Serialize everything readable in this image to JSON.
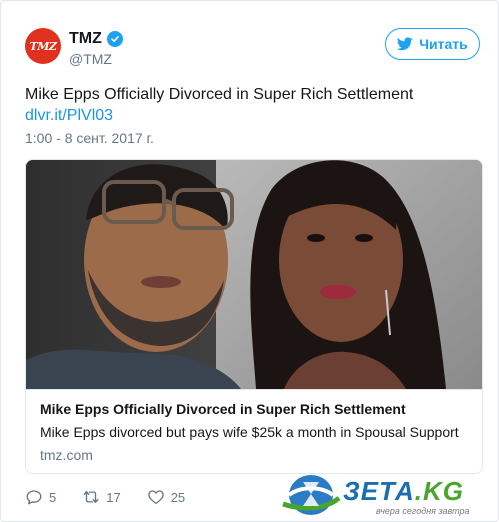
{
  "author": {
    "avatar_text": "TMZ",
    "name": "TMZ",
    "handle": "@TMZ",
    "verified": true
  },
  "follow_button": {
    "label": "Читать",
    "icon": "twitter-bird-icon"
  },
  "tweet": {
    "text": "Mike Epps Officially Divorced in Super Rich Settlement",
    "link": "dlvr.it/PlVl03",
    "timestamp": "1:00 - 8 сент. 2017 г."
  },
  "card": {
    "image_subject": "photo",
    "title": "Mike Epps Officially Divorced in Super Rich Settlement",
    "description": "Mike Epps divorced but pays wife $25k a month in Spousal Support",
    "domain": "tmz.com"
  },
  "actions": {
    "replies": "5",
    "retweets": "17",
    "likes": "25"
  },
  "watermark": {
    "brand_main": "ЗЕТА",
    "brand_tld": ".KG",
    "tagline": "вчера сегодня завтра"
  },
  "colors": {
    "twitter_blue": "#1da1f2",
    "link_blue": "#1b95e0",
    "muted": "#657786",
    "tmz_red": "#e0301e"
  }
}
